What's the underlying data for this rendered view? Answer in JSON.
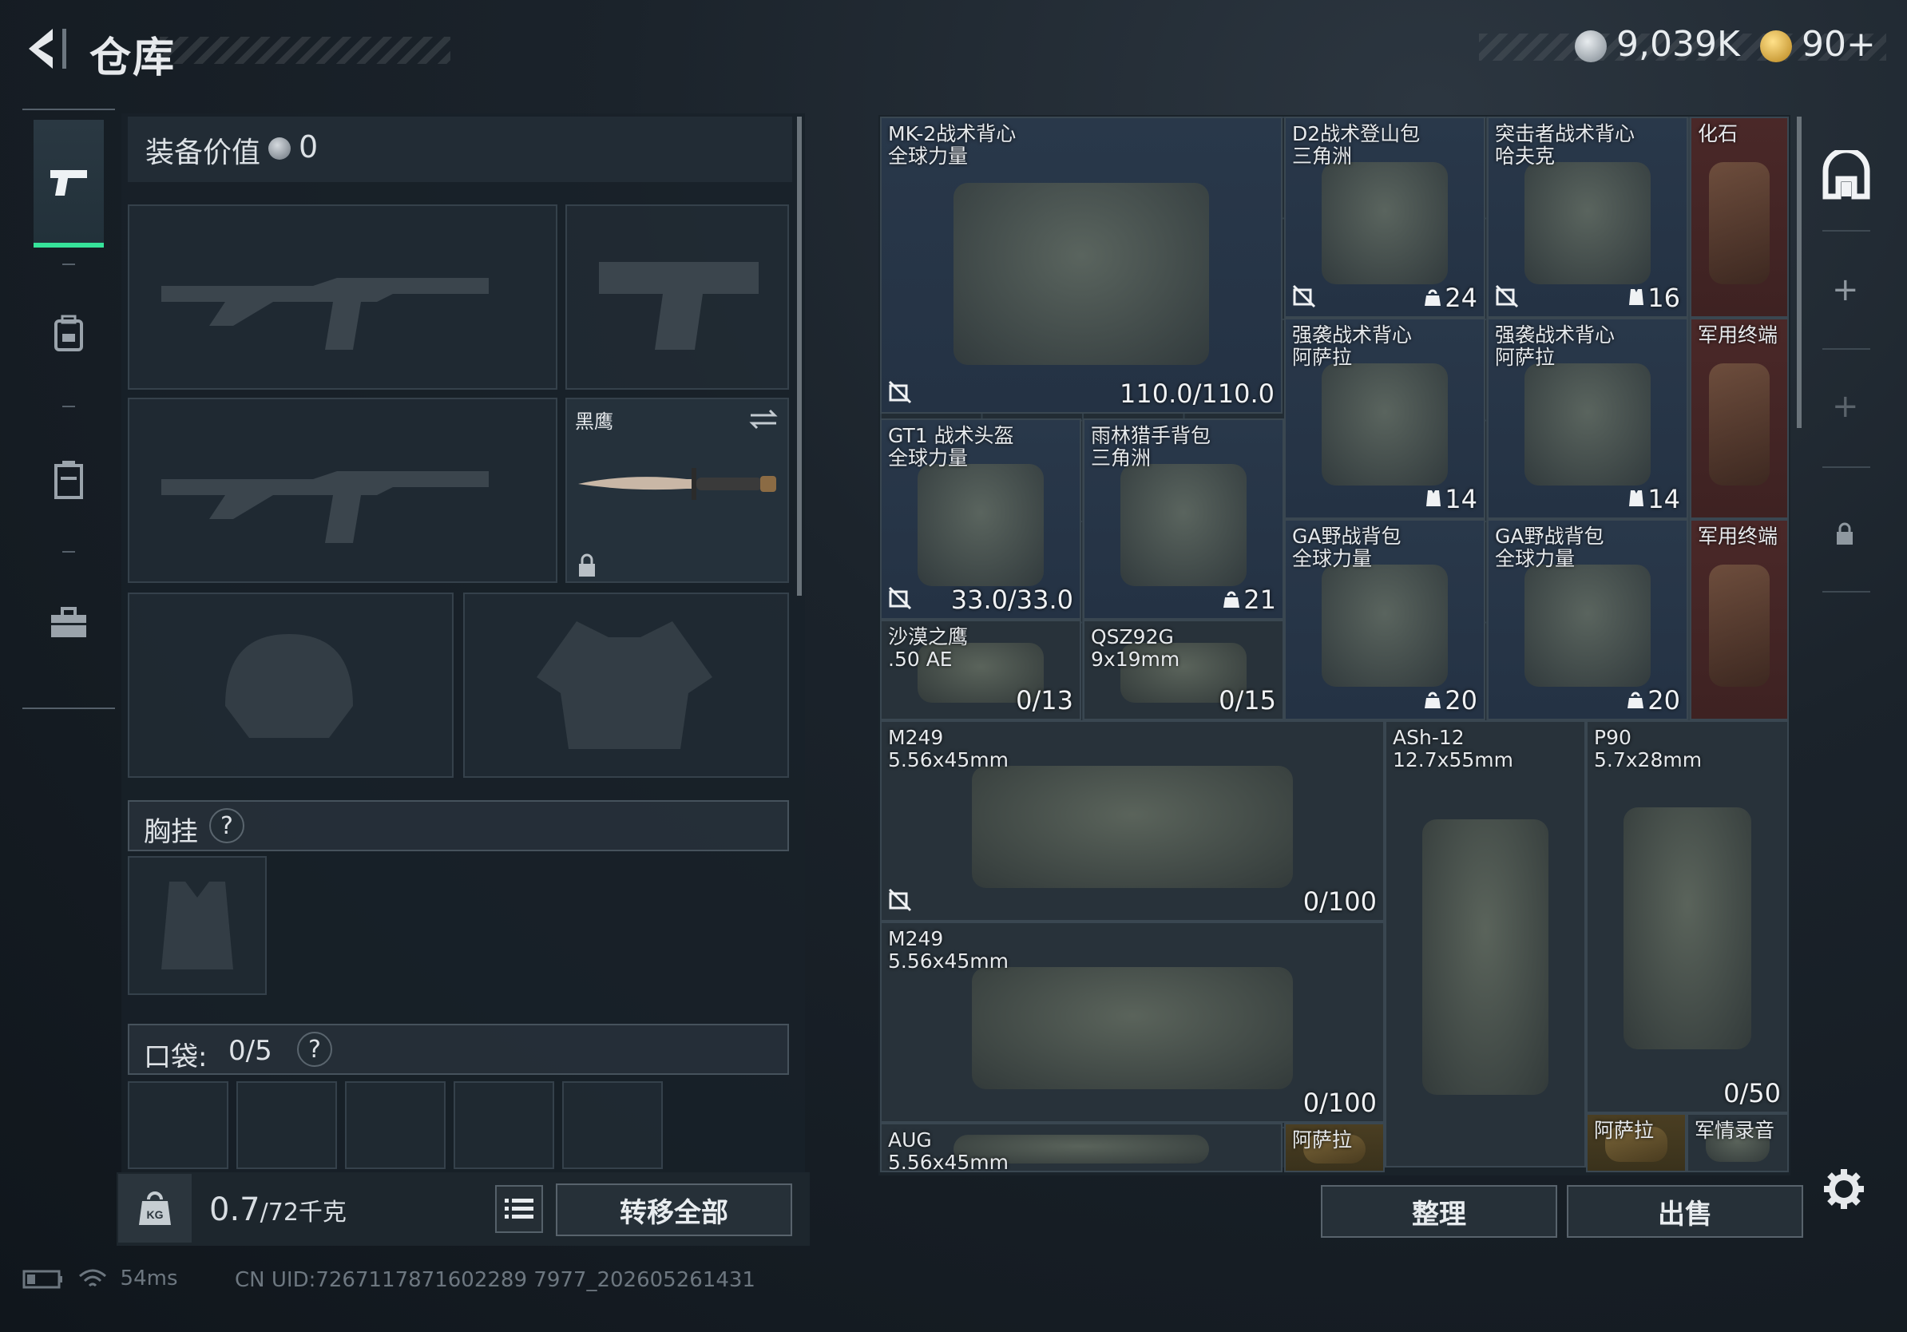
{
  "header": {
    "title": "仓库",
    "money": "9,039K",
    "tickets": "90+"
  },
  "sidebar": {
    "items": [
      {
        "icon": "pistol-icon",
        "active": true
      },
      {
        "icon": "backpack-icon",
        "active": false
      },
      {
        "icon": "container-icon",
        "active": false
      },
      {
        "icon": "briefcase-icon",
        "active": false
      }
    ]
  },
  "equipment": {
    "value_label": "装备价值",
    "value": "0",
    "melee_name": "黑鹰",
    "chest_label": "胸挂",
    "chest_help": "?",
    "pocket_label": "口袋:",
    "pocket_count": "0/5",
    "pocket_help": "?"
  },
  "footer_left": {
    "weight_value": "0.7",
    "weight_cap": "/72千克",
    "transfer_label": "转移全部"
  },
  "status": {
    "ping": "54ms",
    "uid": "CN UID:7267117871602289 7977_202605261431"
  },
  "warehouse": {
    "items": [
      {
        "name": "MK-2战术背心\n全球力量",
        "count": "110.0/110.0",
        "no_icon": true,
        "color": "blue"
      },
      {
        "name": "D2战术登山包\n三角洲",
        "count": "24",
        "count_icon": "weight",
        "no_icon": true,
        "color": "blue"
      },
      {
        "name": "突击者战术背心\n哈夫克",
        "count": "16",
        "count_icon": "vest",
        "no_icon": true,
        "color": "blue"
      },
      {
        "name": "化石",
        "count": "",
        "color": "red"
      },
      {
        "name": "强袭战术背心\n阿萨拉",
        "count": "14",
        "count_icon": "vest",
        "color": "blue"
      },
      {
        "name": "强袭战术背心\n阿萨拉",
        "count": "14",
        "count_icon": "vest",
        "color": "blue"
      },
      {
        "name": "军用终端",
        "count": "",
        "color": "red"
      },
      {
        "name": "GT1 战术头盔\n全球力量",
        "count": "33.0/33.0",
        "no_icon": true,
        "color": "blue"
      },
      {
        "name": "雨林猎手背包\n三角洲",
        "count": "21",
        "count_icon": "weight",
        "color": "blue"
      },
      {
        "name": "GA野战背包\n全球力量",
        "count": "20",
        "count_icon": "weight",
        "color": "blue"
      },
      {
        "name": "GA野战背包\n全球力量",
        "count": "20",
        "count_icon": "weight",
        "color": "blue"
      },
      {
        "name": "军用终端",
        "count": "",
        "color": "red"
      },
      {
        "name": "沙漠之鹰\n.50 AE",
        "count": "0/13",
        "color": "gray"
      },
      {
        "name": "QSZ92G\n9x19mm",
        "count": "0/15",
        "color": "gray"
      },
      {
        "name": "M249\n5.56x45mm",
        "count": "0/100",
        "no_icon": true,
        "color": "gray"
      },
      {
        "name": "ASh-12\n12.7x55mm",
        "count": "",
        "color": "gray"
      },
      {
        "name": "P90\n5.7x28mm",
        "count": "0/50",
        "color": "gray"
      },
      {
        "name": "M249\n5.56x45mm",
        "count": "0/100",
        "color": "gray"
      },
      {
        "name": "AUG\n5.56x45mm",
        "count": "",
        "color": "gray"
      },
      {
        "name": "阿萨拉",
        "count": "",
        "color": "gold"
      },
      {
        "name": "阿萨拉",
        "count": "",
        "color": "gold"
      },
      {
        "name": "军情录音",
        "count": "",
        "color": "gray"
      }
    ]
  },
  "footer_right": {
    "sort_label": "整理",
    "sell_label": "出售"
  }
}
